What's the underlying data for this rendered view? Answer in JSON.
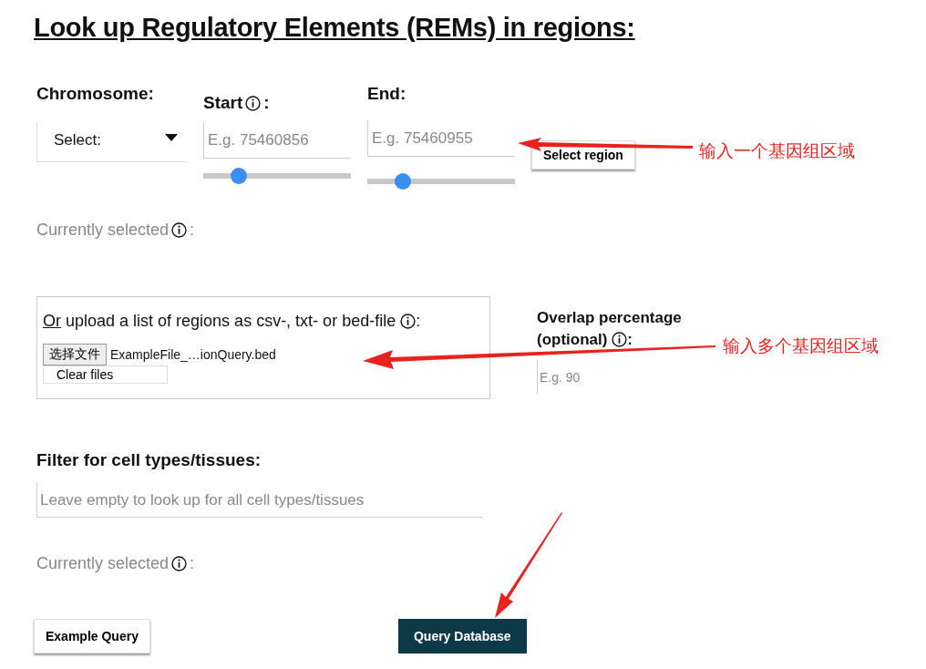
{
  "title": "Look up Regulatory Elements (REMs) in regions:",
  "region": {
    "chromosome": {
      "label": "Chromosome:",
      "value": "Select:"
    },
    "start": {
      "label": "Start",
      "info": true,
      "suffix": ":",
      "placeholder": "E.g. 75460856",
      "level": 0.24
    },
    "end": {
      "label": "End:",
      "info": false,
      "placeholder": "E.g. 75460955",
      "level": 0.24
    },
    "select_button": "Select region",
    "currently_selected": "Currently selected",
    "currently_suffix": ":"
  },
  "upload": {
    "link": "Or",
    "text": "upload a list of regions as csv-, txt- or bed-file",
    "suffix": ":",
    "choose_button": "选择文件",
    "file_name": "ExampleFile_…ionQuery.bed",
    "clear_button": "Clear files"
  },
  "overlap": {
    "label": "Overlap percentage (optional)",
    "suffix": ":",
    "placeholder": "E.g. 90"
  },
  "filter": {
    "label": "Filter for cell types/tissues:",
    "placeholder": "Leave empty to look up for all cell types/tissues",
    "currently_selected": "Currently selected",
    "currently_suffix": ":"
  },
  "buttons": [
    {
      "label": "Example Query",
      "kind": "secondary"
    },
    {
      "label": "Query Database",
      "kind": "primary"
    }
  ],
  "annotations": [
    "输入一个基因组区域",
    "输入多个基因组区域"
  ]
}
